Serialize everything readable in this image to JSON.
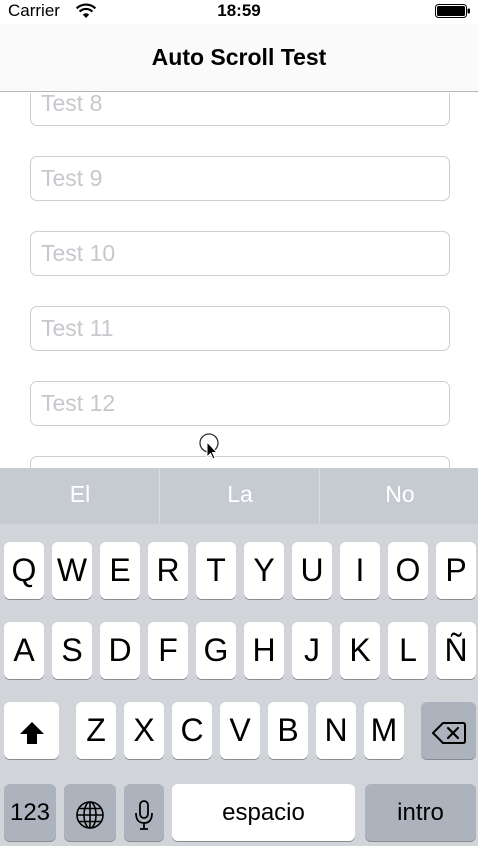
{
  "status_bar": {
    "carrier": "Carrier",
    "time": "18:59"
  },
  "nav": {
    "title": "Auto Scroll Test"
  },
  "fields": [
    {
      "placeholder": "Test 8"
    },
    {
      "placeholder": "Test 9"
    },
    {
      "placeholder": "Test 10"
    },
    {
      "placeholder": "Test 11"
    },
    {
      "placeholder": "Test 12"
    },
    {
      "placeholder": ""
    }
  ],
  "keyboard": {
    "suggestions": [
      "El",
      "La",
      "No"
    ],
    "row1": [
      "Q",
      "W",
      "E",
      "R",
      "T",
      "Y",
      "U",
      "I",
      "O",
      "P"
    ],
    "row2": [
      "A",
      "S",
      "D",
      "F",
      "G",
      "H",
      "J",
      "K",
      "L",
      "Ñ"
    ],
    "row3": [
      "Z",
      "X",
      "C",
      "V",
      "B",
      "N",
      "M"
    ],
    "numbers_label": "123",
    "space_label": "espacio",
    "return_label": "intro",
    "icons": {
      "shift": "shift-icon",
      "delete": "delete-icon",
      "globe": "globe-icon",
      "mic": "microphone-icon"
    }
  }
}
